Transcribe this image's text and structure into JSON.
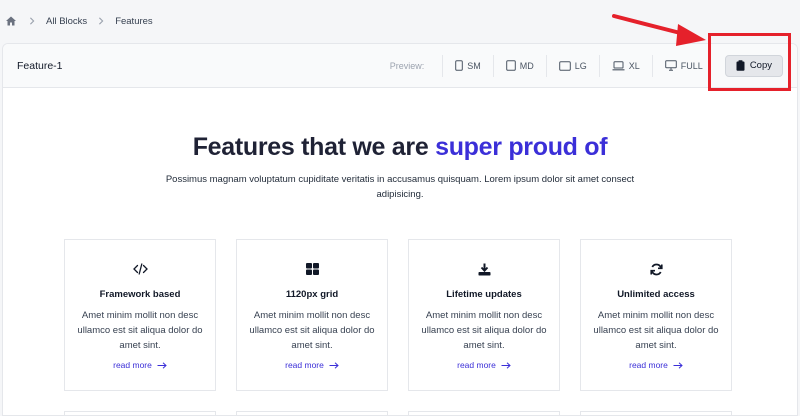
{
  "breadcrumb": {
    "home_icon": "home-icon",
    "items": [
      "All Blocks",
      "Features"
    ]
  },
  "toolbar": {
    "block_title": "Feature-1",
    "preview_label": "Preview:",
    "breakpoints": [
      {
        "label": "SM",
        "icon": "mobile-icon"
      },
      {
        "label": "MD",
        "icon": "tablet-icon"
      },
      {
        "label": "LG",
        "icon": "tablet-landscape-icon"
      },
      {
        "label": "XL",
        "icon": "laptop-icon"
      },
      {
        "label": "FULL",
        "icon": "desktop-icon"
      }
    ],
    "copy_label": "Copy",
    "copy_icon": "clipboard-icon"
  },
  "annotation": {
    "color": "#e5212b"
  },
  "hero": {
    "title_part1": "Features that we are ",
    "title_accent": "super proud of",
    "accent_color": "#3b2fd8",
    "subtitle": "Possimus magnam voluptatum cupiditate veritatis in accusamus quisquam. Lorem ipsum dolor sit amet consect adipisicing."
  },
  "features": [
    {
      "icon": "code-icon",
      "title": "Framework based",
      "description": "Amet minim mollit non desc ullamco est sit aliqua dolor do amet sint.",
      "link": "read more"
    },
    {
      "icon": "grid-icon",
      "title": "1120px grid",
      "description": "Amet minim mollit non desc ullamco est sit aliqua dolor do amet sint.",
      "link": "read more"
    },
    {
      "icon": "download-icon",
      "title": "Lifetime updates",
      "description": "Amet minim mollit non desc ullamco est sit aliqua dolor do amet sint.",
      "link": "read more"
    },
    {
      "icon": "refresh-icon",
      "title": "Unlimited access",
      "description": "Amet minim mollit non desc ullamco est sit aliqua dolor do amet sint.",
      "link": "read more"
    }
  ]
}
